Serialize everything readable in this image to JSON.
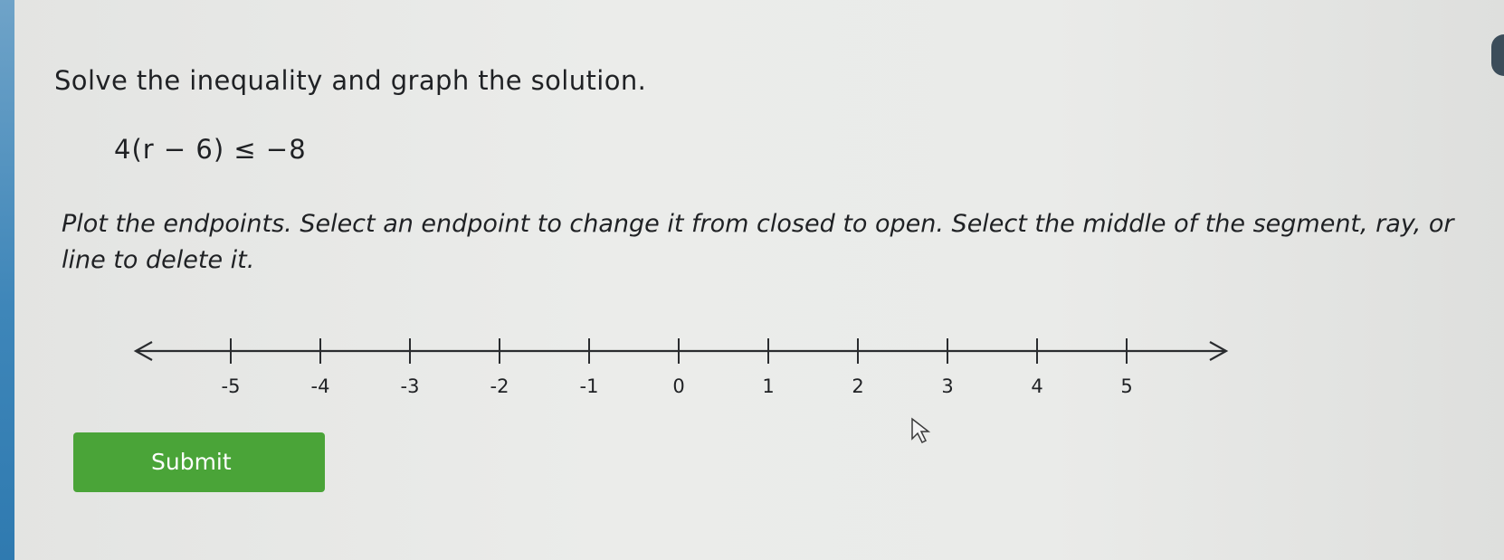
{
  "question": {
    "prompt": "Solve the inequality and graph the solution.",
    "equation": "4(r − 6) ≤ −8"
  },
  "instructions": "Plot the endpoints. Select an endpoint to change it from closed to open. Select the middle of the segment, ray, or line to delete it.",
  "number_line": {
    "ticks": [
      "-5",
      "-4",
      "-3",
      "-2",
      "-1",
      "0",
      "1",
      "2",
      "3",
      "4",
      "5"
    ],
    "range": [
      -5,
      5
    ]
  },
  "submit": {
    "label": "Submit"
  },
  "colors": {
    "submit_background": "#4aa438",
    "edge_accent": "#3e86b9"
  },
  "icons": {
    "pointer": "mouse-pointer-icon"
  }
}
